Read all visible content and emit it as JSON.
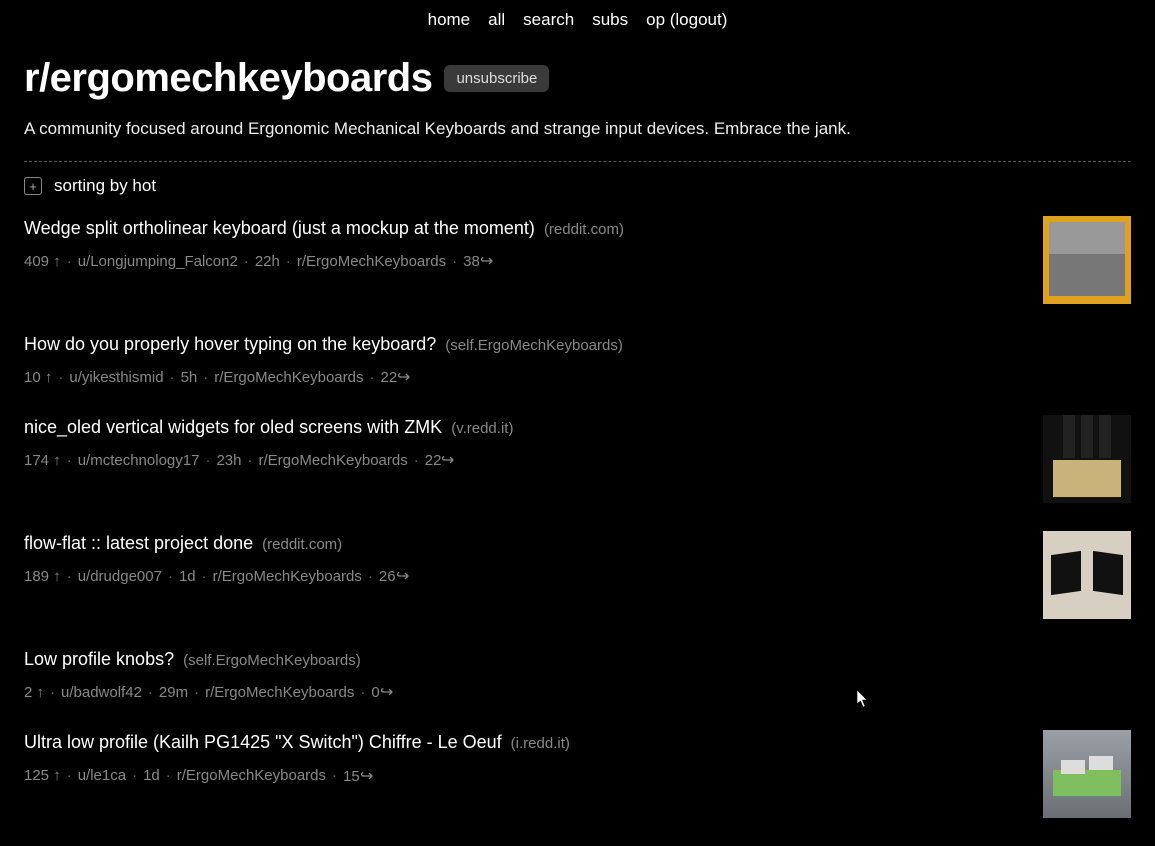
{
  "nav": {
    "home": "home",
    "all": "all",
    "search": "search",
    "subs": "subs",
    "user": "op (logout)"
  },
  "subreddit": {
    "name": "r/ergomechkeyboards",
    "unsubscribe_label": "unsubscribe",
    "description": "A community focused around Ergonomic Mechanical Keyboards and strange input devices. Embrace the jank."
  },
  "sort": {
    "expand_glyph": "+",
    "label": "sorting by hot"
  },
  "posts": [
    {
      "title": "Wedge split ortholinear keyboard (just a mockup at the moment)",
      "domain": "(reddit.com)",
      "score": "409",
      "author": "u/Longjumping_Falcon2",
      "age": "22h",
      "sub": "r/ErgoMechKeyboards",
      "comments": "38",
      "has_thumb": true,
      "thumb_class": "t1"
    },
    {
      "title": "How do you properly hover typing on the keyboard?",
      "domain": "(self.ErgoMechKeyboards)",
      "score": "10",
      "author": "u/yikesthismid",
      "age": "5h",
      "sub": "r/ErgoMechKeyboards",
      "comments": "22",
      "has_thumb": false
    },
    {
      "title": "nice_oled vertical widgets for oled screens with ZMK",
      "domain": "(v.redd.it)",
      "score": "174",
      "author": "u/mctechnology17",
      "age": "23h",
      "sub": "r/ErgoMechKeyboards",
      "comments": "22",
      "has_thumb": true,
      "thumb_class": "t3"
    },
    {
      "title": "flow-flat :: latest project done",
      "domain": "(reddit.com)",
      "score": "189",
      "author": "u/drudge007",
      "age": "1d",
      "sub": "r/ErgoMechKeyboards",
      "comments": "26",
      "has_thumb": true,
      "thumb_class": "t4"
    },
    {
      "title": "Low profile knobs?",
      "domain": "(self.ErgoMechKeyboards)",
      "score": "2",
      "author": "u/badwolf42",
      "age": "29m",
      "sub": "r/ErgoMechKeyboards",
      "comments": "0",
      "has_thumb": false
    },
    {
      "title": "Ultra low profile (Kailh PG1425 \"X Switch\") Chiffre - Le Oeuf",
      "domain": "(i.redd.it)",
      "score": "125",
      "author": "u/le1ca",
      "age": "1d",
      "sub": "r/ErgoMechKeyboards",
      "comments": "15",
      "has_thumb": true,
      "thumb_class": "t6"
    }
  ]
}
